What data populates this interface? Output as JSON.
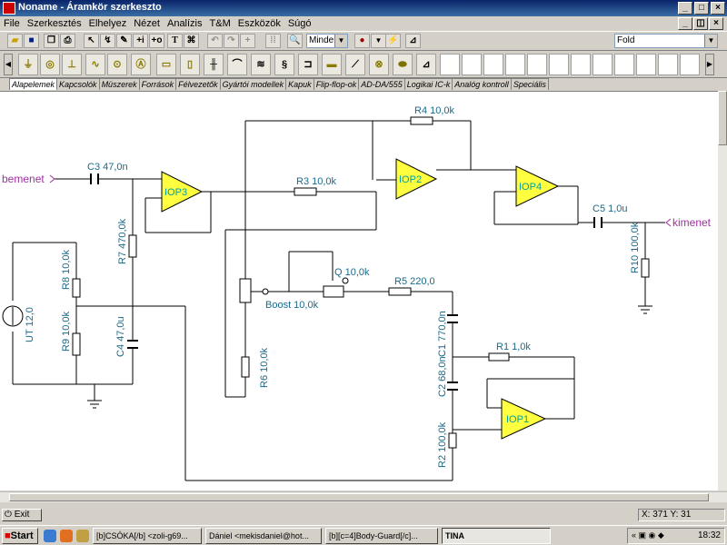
{
  "window": {
    "title": "Noname - Áramkör szerkeszto"
  },
  "menu": [
    "File",
    "Szerkesztés",
    "Elhelyez",
    "Nézet",
    "Analízis",
    "T&M",
    "Eszközök",
    "Súgó"
  ],
  "toolbar": {
    "scope_combo": "Minden",
    "font_combo": "Fold"
  },
  "tabs": [
    "Alapelemek",
    "Kapcsolók",
    "Müszerek",
    "Források",
    "Félvezetők",
    "Gyártói modellek",
    "Kapuk",
    "Flip-flop-ok",
    "AD-DA/555",
    "Logikai IC-k",
    "Analóg kontroll",
    "Speciális"
  ],
  "schematic": {
    "opamps": [
      "IOP3",
      "IOP2",
      "IOP4",
      "IOP1"
    ],
    "labels": {
      "input": "bemenet",
      "output": "kimenet",
      "c3": "C3 47,0n",
      "r3": "R3 10,0k",
      "r4": "R4 10,0k",
      "c5": "C5 1,0u",
      "r10": "R10 100,0k",
      "r7": "R7 470,0k",
      "r8": "R8 10,0k",
      "r9": "R9 10,0k",
      "c4": "C4 47,0u",
      "ut": "UT 12,0",
      "q": "Q 10,0k",
      "boost": "Boost 10,0k",
      "r5": "R5 220,0",
      "r6": "R6 10,0k",
      "c1": "C1 770,0n",
      "c2": "C2 68,0n",
      "r1": "R1 1,0k",
      "r2": "R2 100,0k"
    }
  },
  "statusbar": {
    "exit": "Exit",
    "coords": "X: 371  Y: 31"
  },
  "taskbar": {
    "start": "Start",
    "tasks": [
      "[b]CSÓKA[/b] <zoli-g69...",
      "Dániel <mekisdaniel@hot...",
      "[b][c=4]Body-Guard[/c]...",
      "TINA"
    ],
    "clock": "18:32"
  }
}
